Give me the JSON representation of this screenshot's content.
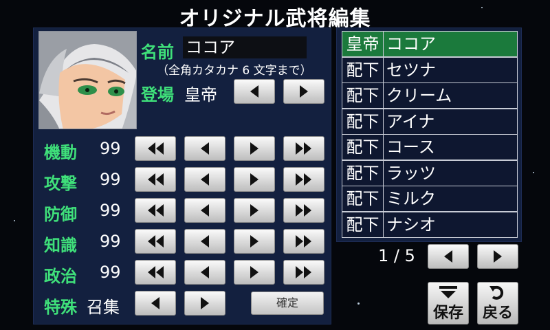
{
  "title": "オリジナル武将編集",
  "name": {
    "label": "名前",
    "value": "ココア",
    "note": "（全角カタカナ 6 文字まで）"
  },
  "appearance": {
    "label": "登場",
    "value": "皇帝"
  },
  "stats": [
    {
      "label": "機動",
      "value": "99"
    },
    {
      "label": "攻撃",
      "value": "99"
    },
    {
      "label": "防御",
      "value": "99"
    },
    {
      "label": "知識",
      "value": "99"
    },
    {
      "label": "政治",
      "value": "99"
    }
  ],
  "special": {
    "label": "特殊",
    "value": "召集"
  },
  "confirm_label": "確定",
  "roster": [
    {
      "role": "皇帝",
      "name": "ココア",
      "selected": true
    },
    {
      "role": "配下",
      "name": "セツナ"
    },
    {
      "role": "配下",
      "name": "クリーム"
    },
    {
      "role": "配下",
      "name": "アイナ"
    },
    {
      "role": "配下",
      "name": "コース"
    },
    {
      "role": "配下",
      "name": "ラッツ"
    },
    {
      "role": "配下",
      "name": "ミルク"
    },
    {
      "role": "配下",
      "name": "ナシオ"
    }
  ],
  "page_indicator": "1 / 5",
  "save_label": "保存",
  "back_label": "戻る",
  "colors": {
    "label_green": "#3fe07a",
    "panel": "#13203f",
    "selected_row": "#1b7a3c"
  }
}
